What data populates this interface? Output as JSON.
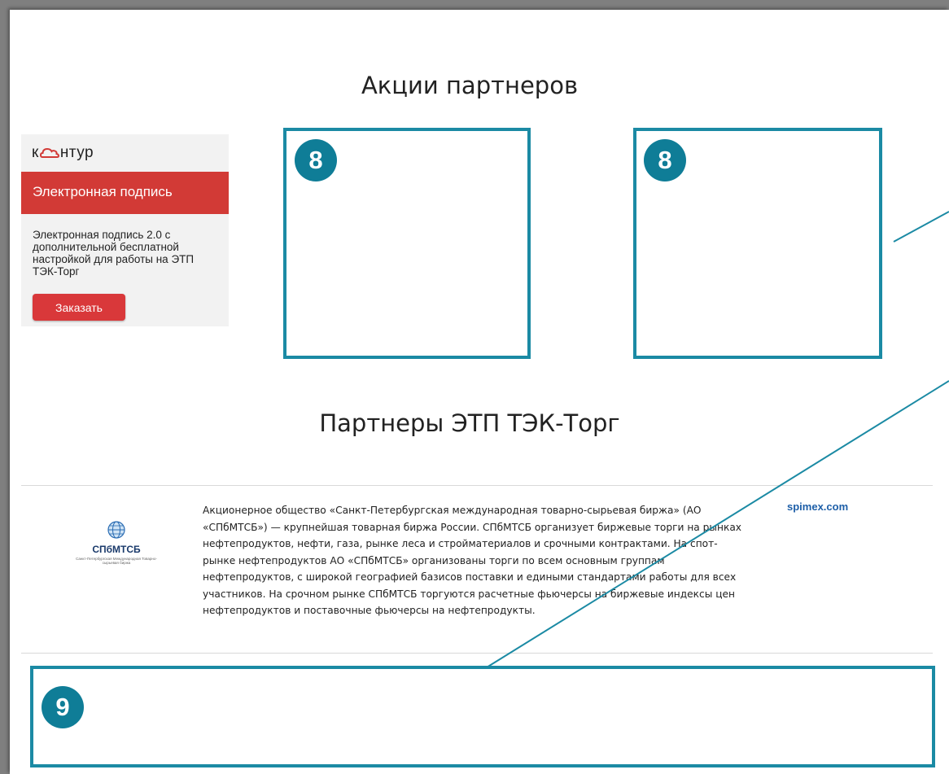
{
  "promo": {
    "title": "Акции партнеров",
    "kontur": {
      "logo_text_before": "к",
      "logo_text_after": "нтур",
      "band_title": "Электронная подпись",
      "description": "Электронная подпись 2.0 с дополнительной бесплатной настройкой для работы на ЭТП ТЭК-Торг",
      "button_label": "Заказать"
    }
  },
  "annotations": {
    "badge_left": "8",
    "badge_right": "8",
    "badge_bottom": "9"
  },
  "partners": {
    "title": "Партнеры ЭТП ТЭК-Торг",
    "items": [
      {
        "logo_name": "СПбМТСБ",
        "logo_subtitle": "Санкт-Петербургская Международная Товарно-сырьевая биржа",
        "description": "Акционерное общество «Санкт-Петербургская международная товарно-сырьевая биржа» (АО «СПбМТСБ») — крупнейшая товарная биржа России. СПбМТСБ организует биржевые торги на рынках нефтепродуктов, нефти, газа, рынке леса и стройматериалов и срочными контрактами. На спот-рынке нефтепродуктов АО «СПбМТСБ» организованы торги по всем основным группам нефтепродуктов, с широкой географией базисов поставки и едиными стандартами работы для всех участников. На срочном рынке СПбМТСБ торгуются расчетные фьючерсы на биржевые индексы цен нефтепродуктов и поставочные фьючерсы на нефтепродукты.",
        "link": "spimex.com"
      }
    ]
  },
  "colors": {
    "callout": "#1b8aa4",
    "badge": "#0f7d97",
    "kontur_red": "#d23a36",
    "link": "#1e5fa8"
  }
}
